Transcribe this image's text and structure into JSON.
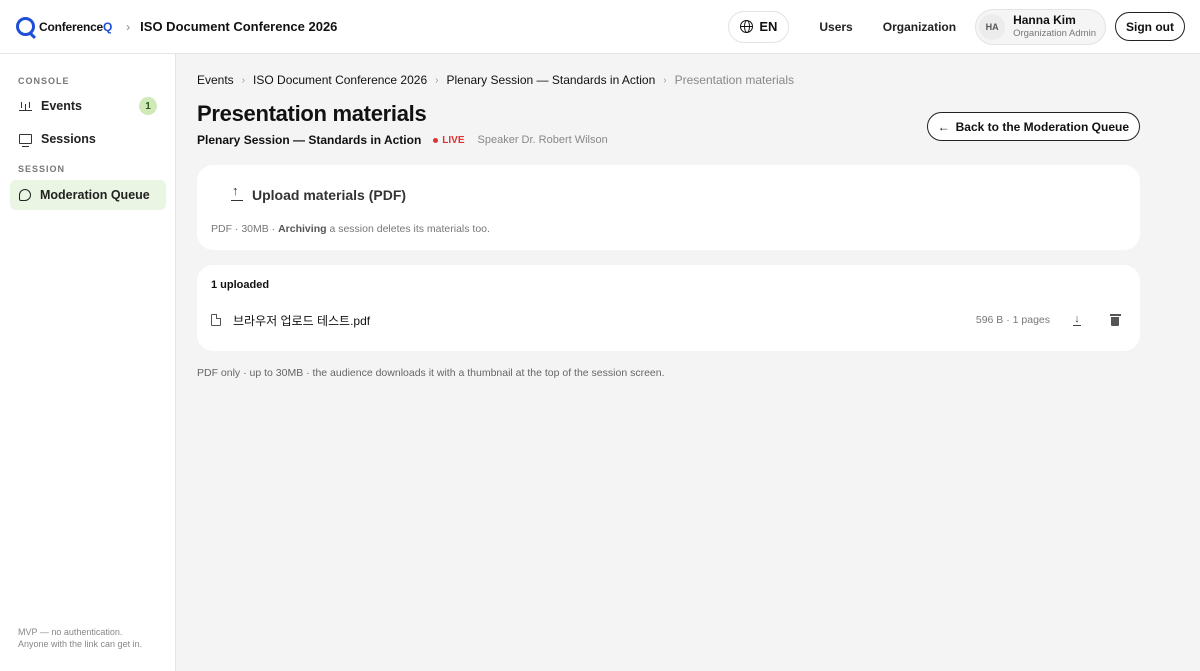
{
  "header": {
    "logo_prefix": "Conference",
    "logo_suffix": "Q",
    "event_title": "ISO Document Conference 2026",
    "lang_label": "EN",
    "nav": [
      "Users",
      "Organization"
    ],
    "user": {
      "initials": "HA",
      "name": "Hanna Kim",
      "role": "Organization Admin"
    },
    "signout_label": "Sign out"
  },
  "sidebar": {
    "console_label": "CONSOLE",
    "session_label": "SESSION",
    "items": [
      {
        "label": "Events",
        "icon": "events-icon",
        "badge": "1"
      },
      {
        "label": "Sessions",
        "icon": "monitor-icon"
      },
      {
        "label": "Moderation Queue",
        "icon": "chat-icon",
        "active": true
      }
    ],
    "footer_line1": "MVP — no authentication.",
    "footer_line2": "Anyone with the link can get in."
  },
  "breadcrumb": [
    "Events",
    "ISO Document Conference 2026",
    "Plenary Session — Standards in Action",
    "Presentation materials"
  ],
  "page": {
    "title": "Presentation materials",
    "session_name": "Plenary Session — Standards in Action",
    "live_label": "LIVE",
    "speaker": "Speaker Dr. Robert Wilson",
    "back_label": "Back to the Moderation Queue"
  },
  "upload": {
    "button_label": "Upload materials (PDF)",
    "note_prefix": "PDF · 30MB · ",
    "note_bold": "Archiving",
    "note_suffix": " a session deletes its materials too."
  },
  "files": {
    "count_label": "1 uploaded",
    "items": [
      {
        "name": "브라우저 업로드 테스트.pdf",
        "meta": "596 B · 1 pages"
      }
    ]
  },
  "footer_note": "PDF only · up to 30MB · the audience downloads it with a thumbnail at the top of the session screen.",
  "colors": {
    "accent": "#1d4ed8",
    "active_bg": "#eaf6e3",
    "badge_bg": "#cfeab8",
    "live": "#d33333"
  }
}
